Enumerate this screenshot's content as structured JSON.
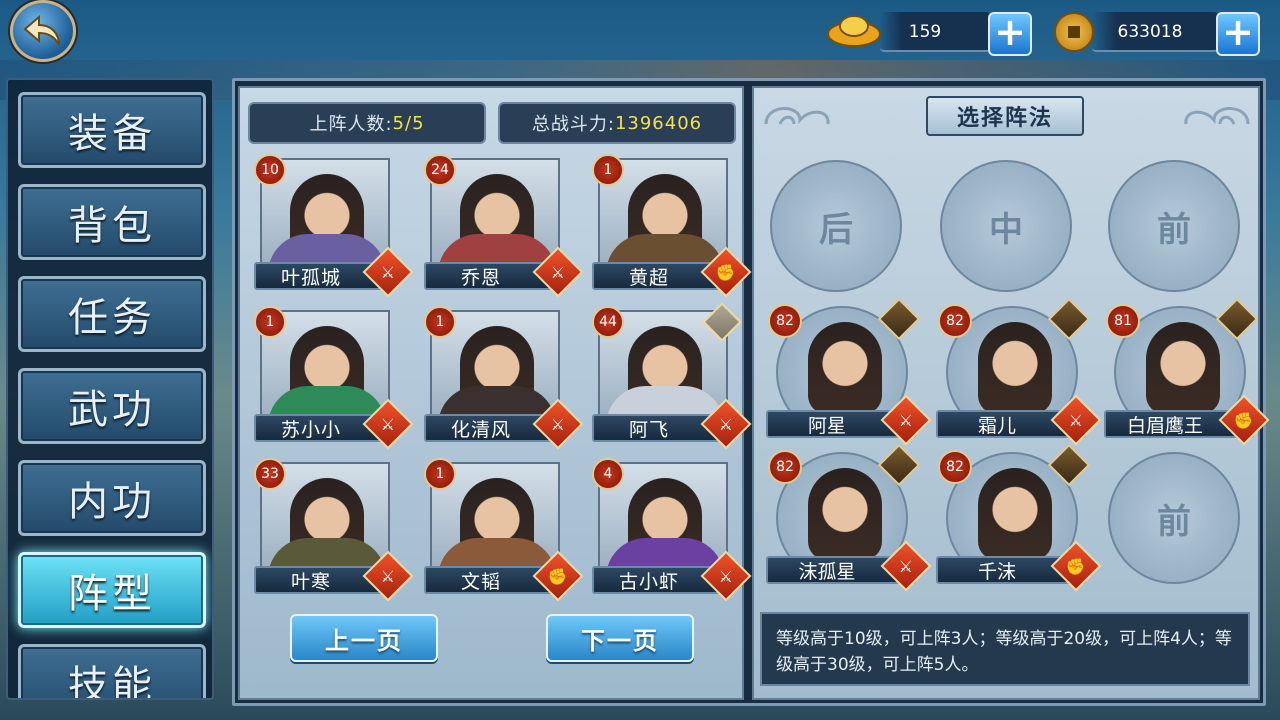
{
  "currency": {
    "gold": "159",
    "coins": "633018"
  },
  "tabs": [
    "装备",
    "背包",
    "任务",
    "武功",
    "内功",
    "阵型",
    "技能"
  ],
  "active_tab": "阵型",
  "team_count_label": "上阵人数:",
  "team_count": "5/5",
  "power_label": "总战斗力:",
  "power": "1396406",
  "roster": [
    {
      "name": "叶孤城",
      "level": "10",
      "role": "⚔",
      "skin": "#6a5fa0"
    },
    {
      "name": "乔恩",
      "level": "24",
      "role": "⚔",
      "skin": "#a04040"
    },
    {
      "name": "黄超",
      "level": "1",
      "role": "✊",
      "skin": "#6a5030"
    },
    {
      "name": "苏小小",
      "level": "1",
      "role": "⚔",
      "skin": "#2f8a5a"
    },
    {
      "name": "化清风",
      "level": "1",
      "role": "⚔",
      "skin": "#3a3030"
    },
    {
      "name": "阿飞",
      "level": "44",
      "role": "⚔",
      "skin": "#c8d0dc"
    },
    {
      "name": "叶寒",
      "level": "33",
      "role": "⚔",
      "skin": "#5a5a3a"
    },
    {
      "name": "文韬",
      "level": "1",
      "role": "✊",
      "skin": "#8a5a3a"
    },
    {
      "name": "古小虾",
      "level": "4",
      "role": "⚔",
      "skin": "#6a40a0"
    }
  ],
  "prev_page": "上一页",
  "next_page": "下一页",
  "formation_title": "选择阵法",
  "slots": [
    "后",
    "中",
    "前",
    "前"
  ],
  "lineup": [
    {
      "name": "阿星",
      "level": "82",
      "role": "⚔"
    },
    {
      "name": "霜儿",
      "level": "82",
      "role": "⚔"
    },
    {
      "name": "白眉鹰王",
      "level": "81",
      "role": "✊"
    },
    {
      "name": "沫孤星",
      "level": "82",
      "role": "⚔"
    },
    {
      "name": "千沫",
      "level": "82",
      "role": "✊"
    }
  ],
  "description": "等级高于10级，可上阵3人；等级高于20级，可上阵4人；等级高于30级，可上阵5人。"
}
